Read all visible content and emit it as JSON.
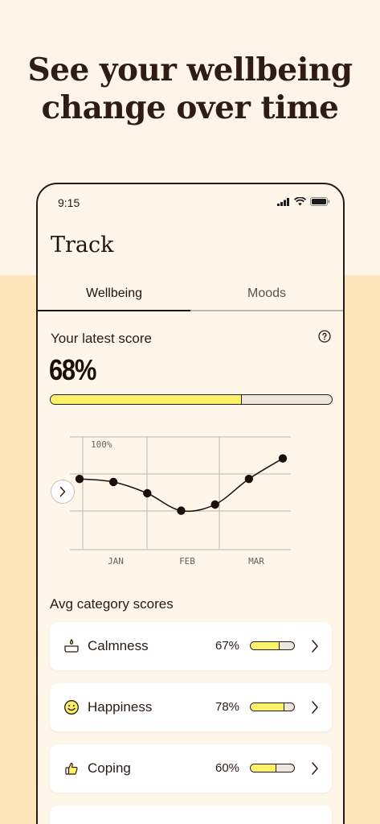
{
  "headline": {
    "line1": "See your wellbeing",
    "line2": "change over time"
  },
  "status": {
    "time": "9:15",
    "icons": [
      "signal-icon",
      "wifi-icon",
      "battery-icon"
    ]
  },
  "screen": {
    "title": "Track"
  },
  "tabs": [
    {
      "label": "Wellbeing",
      "active": true
    },
    {
      "label": "Moods",
      "active": false
    }
  ],
  "score": {
    "label": "Your latest score",
    "value": "68%",
    "fraction": 0.68,
    "help_icon": "question-circle-icon"
  },
  "chart_data": {
    "type": "line",
    "categories": [
      "JAN",
      "FEB",
      "MAR"
    ],
    "y_label": "100%",
    "x": [
      0,
      1,
      2,
      3,
      4,
      5,
      6
    ],
    "values": [
      69,
      66,
      55,
      38,
      44,
      69,
      89
    ],
    "ylim": [
      0,
      110
    ],
    "grid": true,
    "nav_icon": "chevron-right-icon"
  },
  "categories_section": {
    "label": "Avg category scores",
    "items": [
      {
        "name": "Calmness",
        "percent": "67%",
        "fraction": 0.67,
        "icon": "candle-icon"
      },
      {
        "name": "Happiness",
        "percent": "78%",
        "fraction": 0.78,
        "icon": "smiley-icon"
      },
      {
        "name": "Coping",
        "percent": "60%",
        "fraction": 0.6,
        "icon": "thumbs-up-icon"
      },
      {
        "name": "",
        "percent": "",
        "fraction": 0,
        "icon": ""
      }
    ]
  },
  "colors": {
    "background_top": "#FEF5E8",
    "background_bottom": "#FEE6BC",
    "accent_fill": "#FBF26A",
    "ink": "#2B1A14"
  }
}
